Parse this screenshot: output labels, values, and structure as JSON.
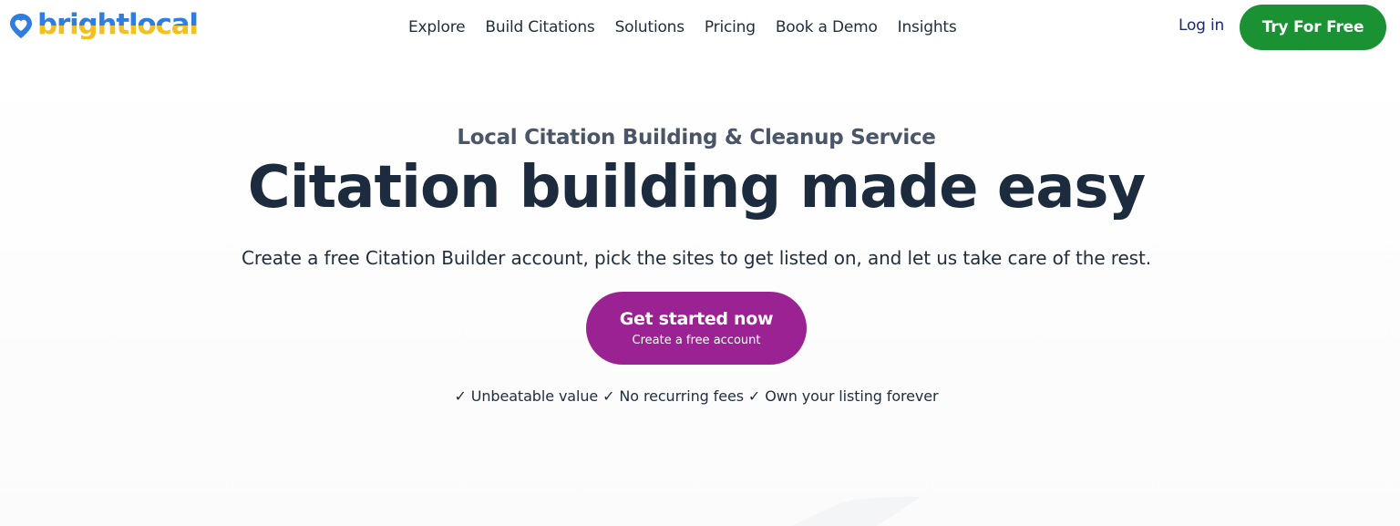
{
  "header": {
    "logo_text": "brightlocal",
    "logo_icon": "map-pin-heart-icon",
    "nav": [
      {
        "label": "Explore"
      },
      {
        "label": "Build Citations"
      },
      {
        "label": "Solutions"
      },
      {
        "label": "Pricing"
      },
      {
        "label": "Book a Demo"
      },
      {
        "label": "Insights"
      }
    ],
    "login_label": "Log in",
    "try_label": "Try For Free"
  },
  "hero": {
    "eyebrow": "Local Citation Building & Cleanup Service",
    "headline": "Citation building made easy",
    "subtext": "Create a free Citation Builder account, pick the sites to get listed on, and let us take care of the rest.",
    "cta_main": "Get started now",
    "cta_sub": "Create a free account",
    "benefits": "✓ Unbeatable value ✓ No recurring fees ✓ Own your listing forever"
  },
  "colors": {
    "brand_blue": "#2f7de1",
    "brand_yellow": "#f4c021",
    "try_button_green": "#1a9132",
    "cta_purple": "#9b2293",
    "heading_navy": "#1c2b3d",
    "login_navy": "#1a2a6c"
  }
}
